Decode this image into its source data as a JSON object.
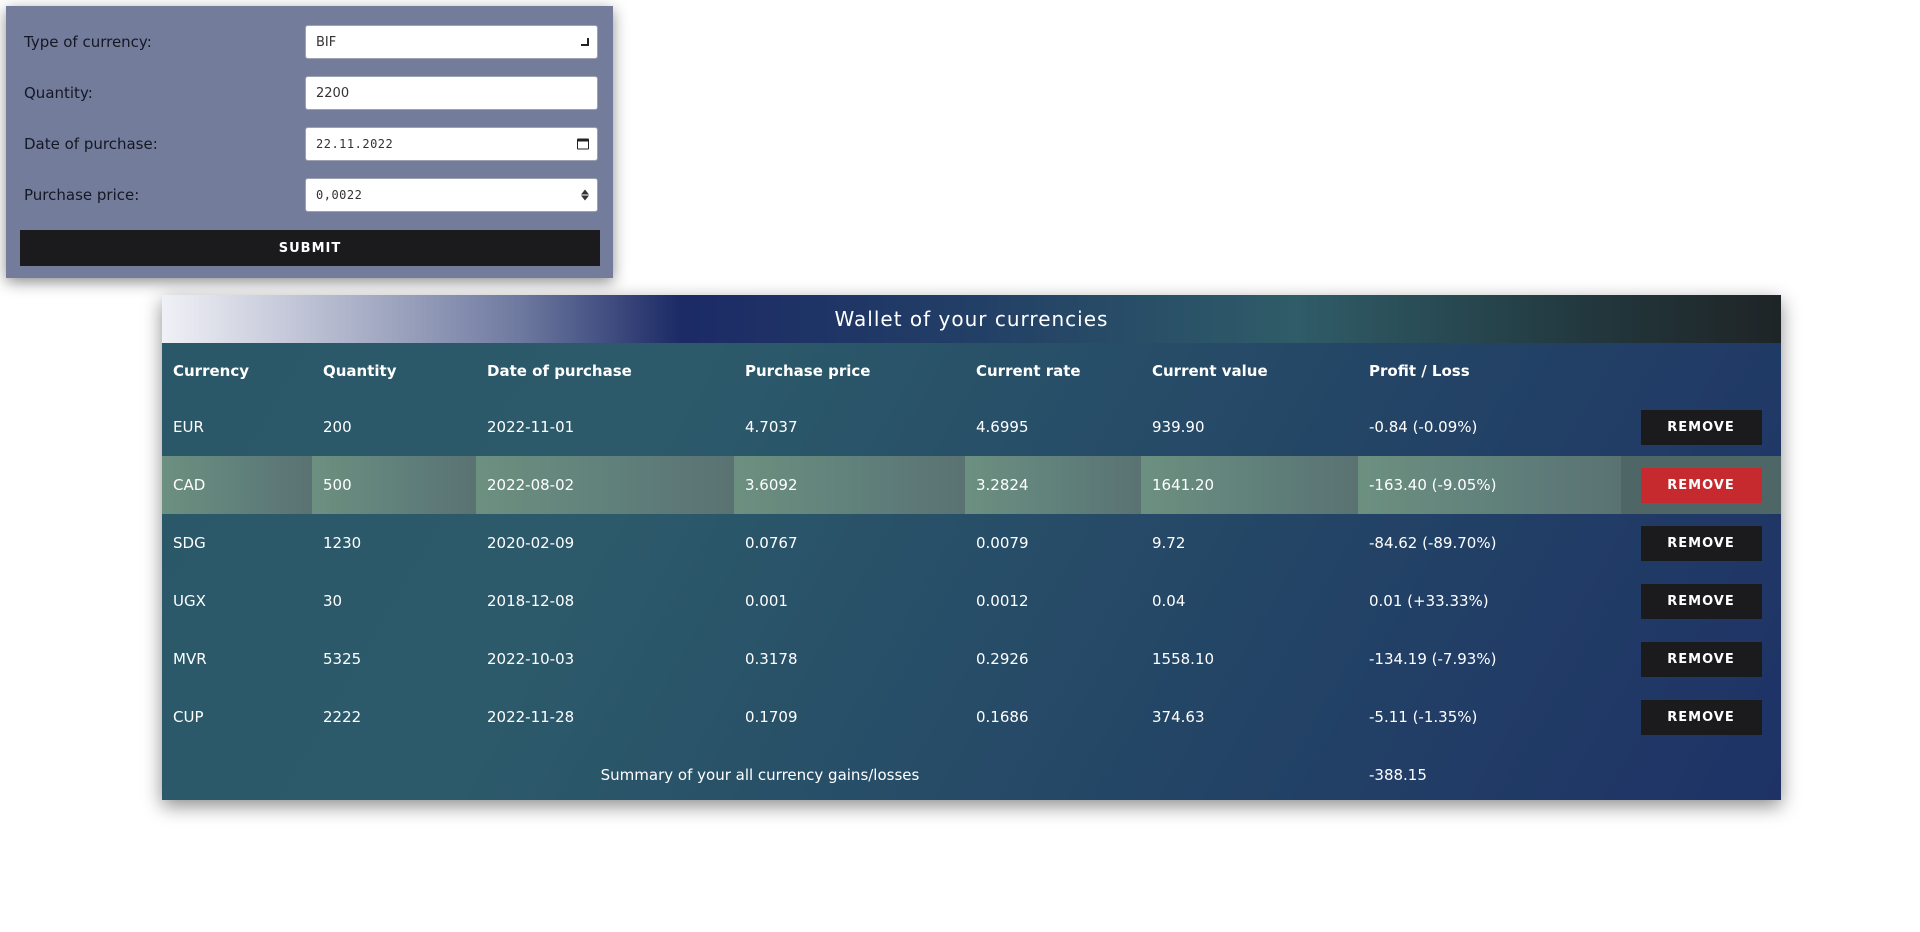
{
  "form": {
    "currency_label": "Type of currency:",
    "currency_value": "BIF",
    "quantity_label": "Quantity:",
    "quantity_value": "2200",
    "date_label": "Date of purchase:",
    "date_value": "22.11.2022",
    "price_label": "Purchase price:",
    "price_value": "0,0022",
    "submit_label": "SUBMIT",
    "icons": {
      "select": "chevron-down-icon",
      "date": "calendar-icon",
      "number": "spinner-icon"
    }
  },
  "wallet": {
    "title": "Wallet of your currencies",
    "headers": {
      "currency": "Currency",
      "quantity": "Quantity",
      "date": "Date of purchase",
      "purchase_price": "Purchase price",
      "current_rate": "Current rate",
      "current_value": "Current value",
      "profit_loss": "Profit / Loss"
    },
    "remove_label": "REMOVE",
    "rows": [
      {
        "currency": "EUR",
        "quantity": "200",
        "date": "2022-11-01",
        "purchase_price": "4.7037",
        "current_rate": "4.6995",
        "current_value": "939.90",
        "profit_loss": "-0.84 (-0.09%)"
      },
      {
        "currency": "CAD",
        "quantity": "500",
        "date": "2022-08-02",
        "purchase_price": "3.6092",
        "current_rate": "3.2824",
        "current_value": "1641.20",
        "profit_loss": "-163.40 (-9.05%)"
      },
      {
        "currency": "SDG",
        "quantity": "1230",
        "date": "2020-02-09",
        "purchase_price": "0.0767",
        "current_rate": "0.0079",
        "current_value": "9.72",
        "profit_loss": "-84.62 (-89.70%)"
      },
      {
        "currency": "UGX",
        "quantity": "30",
        "date": "2018-12-08",
        "purchase_price": "0.001",
        "current_rate": "0.0012",
        "current_value": "0.04",
        "profit_loss": "0.01 (+33.33%)"
      },
      {
        "currency": "MVR",
        "quantity": "5325",
        "date": "2022-10-03",
        "purchase_price": "0.3178",
        "current_rate": "0.2926",
        "current_value": "1558.10",
        "profit_loss": "-134.19 (-7.93%)"
      },
      {
        "currency": "CUP",
        "quantity": "2222",
        "date": "2022-11-28",
        "purchase_price": "0.1709",
        "current_rate": "0.1686",
        "current_value": "374.63",
        "profit_loss": "-5.11 (-1.35%)"
      }
    ],
    "summary_label": "Summary of your all currency gains/losses",
    "summary_value": "-388.15"
  },
  "colors": {
    "form_bg": "#747c9c",
    "button_dark": "#1b1b1e",
    "remove_active": "#c62a2e",
    "highlight_row": "#6c9080"
  }
}
